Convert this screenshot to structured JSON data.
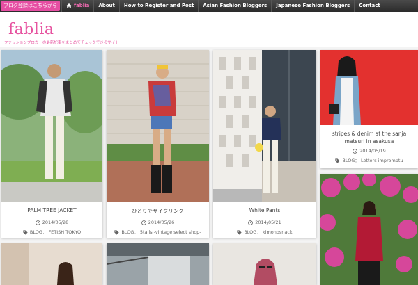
{
  "nav": {
    "register_label": "ブログ登録はこちらから",
    "home_label": "fablia",
    "items": [
      "About",
      "How to Register and Post",
      "Asian Fashion Bloggers",
      "Japanese Fashion Bloggers",
      "Contact"
    ]
  },
  "header": {
    "logo": "fablia",
    "tagline": "ファッションブロガーの最新記事をまとめてチェックできるサイト"
  },
  "colors": {
    "accent": "#e6529f",
    "nav_bg": "#333333"
  },
  "posts": [
    {
      "title": "PALM TREE JACKET",
      "date": "2014/05/28",
      "blog": "BLOG： FETISH TOKYO"
    },
    {
      "title": "ひとりでサイクリング",
      "date": "2014/05/26",
      "blog": "BLOG： 5tails -vintage select shop-"
    },
    {
      "title": "White Pants",
      "date": "2014/05/21",
      "blog": "BLOG： kimonosnack"
    },
    {
      "title": "stripes & denim at the sanja matsuri in asakusa",
      "date": "2014/05/19",
      "blog": "BLOG： Letters impromptu"
    }
  ],
  "icons": {
    "home": "home-icon",
    "clock": "clock-icon",
    "tag": "tag-icon"
  }
}
